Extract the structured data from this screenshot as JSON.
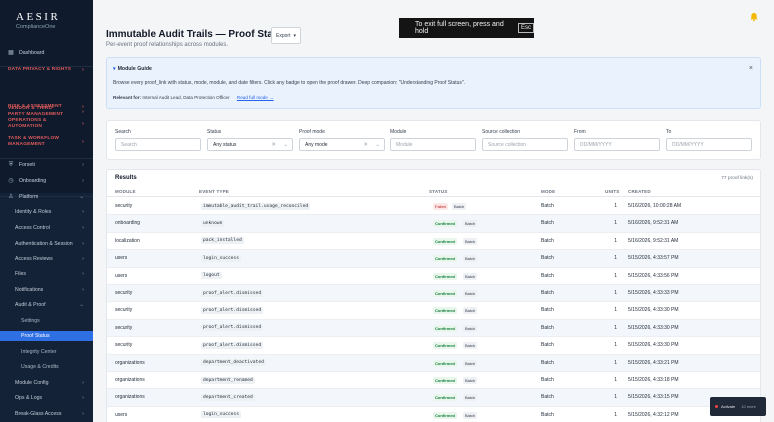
{
  "brand": {
    "name": "AESIR",
    "sub": "ComplianceOne"
  },
  "sidebar": {
    "items": [
      {
        "label": "Dashboard",
        "icon": "grid-icon",
        "kind": "top"
      },
      {
        "label": "DATA PRIVACY & RIGHTS",
        "kind": "cat"
      },
      {
        "label": "VENDOR & THIRD-PARTY MANAGEMENT",
        "kind": "cat2"
      },
      {
        "label": "RISK & ASSESSMENT",
        "kind": "cat"
      },
      {
        "label": "OPERATIONS & AUTOMATION",
        "kind": "cat2"
      },
      {
        "label": "TASK & WORKFLOW MANAGEMENT",
        "kind": "cat2"
      },
      {
        "label": "Forseti",
        "icon": "shield-icon",
        "kind": "top"
      },
      {
        "label": "Onboarding",
        "icon": "clock-icon",
        "kind": "top"
      },
      {
        "label": "Platform",
        "icon": "user-icon",
        "kind": "top"
      },
      {
        "label": "Identity & Roles",
        "kind": "sub"
      },
      {
        "label": "Access Control",
        "kind": "sub"
      },
      {
        "label": "Authentication & Session",
        "kind": "sub"
      },
      {
        "label": "Access Reviews",
        "kind": "sub"
      },
      {
        "label": "Files",
        "kind": "sub"
      },
      {
        "label": "Notifications",
        "kind": "sub"
      },
      {
        "label": "Audit & Proof",
        "kind": "sub"
      },
      {
        "label": "Settings",
        "kind": "sub2"
      },
      {
        "label": "Proof Status",
        "kind": "sub2"
      },
      {
        "label": "Integrity Center",
        "kind": "sub2"
      },
      {
        "label": "Usage & Credits",
        "kind": "sub2"
      },
      {
        "label": "Module Config",
        "kind": "sub"
      },
      {
        "label": "Ops & Logs",
        "kind": "sub"
      },
      {
        "label": "Break-Glass Access",
        "kind": "sub"
      }
    ]
  },
  "header": {
    "title": "Immutable Audit Trails — Proof Status",
    "subtitle": "Per-event proof relationships across modules.",
    "export_label": "Export",
    "fullscreen_hint": "To exit full screen, press and hold",
    "fullscreen_key": "Esc"
  },
  "guide": {
    "title": "Module Guide",
    "text": "Browse every proof_link with status, mode, module, and date filters. Click any badge to open the proof drawer. Deep companion: \"Understanding Proof Status\".",
    "relevant_label": "Relevant for:",
    "relevant_value": "Internal Audit Lead, Data Protection Officer",
    "link": "Read full mode →",
    "close": "×"
  },
  "filters": {
    "search": {
      "label": "Search",
      "placeholder": "Search"
    },
    "status": {
      "label": "Status",
      "value": "Any status"
    },
    "proof_mode": {
      "label": "Proof mode",
      "value": "Any mode"
    },
    "module": {
      "label": "Module",
      "placeholder": "Module"
    },
    "source": {
      "label": "Source collection",
      "placeholder": "Source collection"
    },
    "from": {
      "label": "From",
      "placeholder": "DD/MM/YYYY"
    },
    "to": {
      "label": "To",
      "placeholder": "DD/MM/YYYY"
    }
  },
  "results": {
    "title": "Results",
    "count": "77 proof link(s)",
    "columns": [
      "MODULE",
      "EVENT TYPE",
      "STATUS",
      "MODE",
      "UNITS",
      "CREATED"
    ],
    "rows": [
      {
        "module": "security",
        "event": "immutable_audit_trail.usage_reconciled",
        "status": "Failed",
        "mode_badge": "Batch",
        "mode": "Batch",
        "units": "1",
        "created": "5/16/2026, 10:00:28 AM"
      },
      {
        "module": "onboarding",
        "event": "unknown",
        "status": "Confirmed",
        "mode_badge": "Batch",
        "mode": "Batch",
        "units": "1",
        "created": "5/16/2026, 9:52:31 AM"
      },
      {
        "module": "localization",
        "event": "pack_installed",
        "status": "Confirmed",
        "mode_badge": "Batch",
        "mode": "Batch",
        "units": "1",
        "created": "5/16/2026, 9:52:31 AM"
      },
      {
        "module": "users",
        "event": "login_success",
        "status": "Confirmed",
        "mode_badge": "Batch",
        "mode": "Batch",
        "units": "1",
        "created": "5/15/2026, 4:33:57 PM"
      },
      {
        "module": "users",
        "event": "logout",
        "status": "Confirmed",
        "mode_badge": "Batch",
        "mode": "Batch",
        "units": "1",
        "created": "5/15/2026, 4:33:56 PM"
      },
      {
        "module": "security",
        "event": "proof_alert.dismissed",
        "status": "Confirmed",
        "mode_badge": "Batch",
        "mode": "Batch",
        "units": "1",
        "created": "5/15/2026, 4:33:33 PM"
      },
      {
        "module": "security",
        "event": "proof_alert.dismissed",
        "status": "Confirmed",
        "mode_badge": "Batch",
        "mode": "Batch",
        "units": "1",
        "created": "5/15/2026, 4:33:30 PM"
      },
      {
        "module": "security",
        "event": "proof_alert.dismissed",
        "status": "Confirmed",
        "mode_badge": "Batch",
        "mode": "Batch",
        "units": "1",
        "created": "5/15/2026, 4:33:30 PM"
      },
      {
        "module": "security",
        "event": "proof_alert.dismissed",
        "status": "Confirmed",
        "mode_badge": "Batch",
        "mode": "Batch",
        "units": "1",
        "created": "5/15/2026, 4:33:30 PM"
      },
      {
        "module": "organizations",
        "event": "department_deactivated",
        "status": "Confirmed",
        "mode_badge": "Batch",
        "mode": "Batch",
        "units": "1",
        "created": "5/15/2026, 4:33:21 PM"
      },
      {
        "module": "organizations",
        "event": "department_renamed",
        "status": "Confirmed",
        "mode_badge": "Batch",
        "mode": "Batch",
        "units": "1",
        "created": "5/15/2026, 4:33:18 PM"
      },
      {
        "module": "organizations",
        "event": "department_created",
        "status": "Confirmed",
        "mode_badge": "Batch",
        "mode": "Batch",
        "units": "1",
        "created": "5/15/2026, 4:33:15 PM"
      },
      {
        "module": "users",
        "event": "login_success",
        "status": "Confirmed",
        "mode_badge": "Batch",
        "mode": "Batch",
        "units": "1",
        "created": "5/15/2026, 4:32:12 PM"
      }
    ]
  },
  "toast": {
    "label": "Activate",
    "sub": "10 more"
  }
}
